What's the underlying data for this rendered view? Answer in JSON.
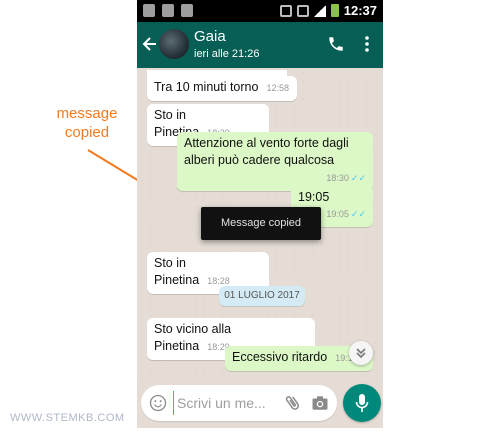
{
  "annotation": {
    "label": "message copied",
    "color": "#f47a20"
  },
  "watermark": {
    "text": "WWW.STEMKB.COM",
    "color": "#b0b8c8"
  },
  "status_bar": {
    "time": "12:37",
    "icons": [
      "facebook-icon",
      "image-icon",
      "recycle-icon",
      "vibrate-icon",
      "network-icon",
      "signal-icon",
      "battery-icon"
    ]
  },
  "header": {
    "contact_name": "Gaia",
    "last_seen": "ieri alle 21:26",
    "color": "#075e54",
    "icons": [
      "back-arrow-icon",
      "avatar",
      "phone-icon",
      "more-vert-icon"
    ]
  },
  "messages": [
    {
      "dir": "in",
      "text": "Tra 10 minuti torno",
      "time": "12:58"
    },
    {
      "dir": "in",
      "text": "Sto in Pinetina",
      "time": "18:29"
    },
    {
      "dir": "out",
      "text": "Attenzione al vento forte dagli alberi può cadere qualcosa",
      "time": "18:30"
    },
    {
      "dir": "out",
      "text": "19:05",
      "time": "19:05"
    },
    {
      "dir": "in",
      "text": "Sto in Pinetina",
      "time": "18:28"
    },
    {
      "dir": "in",
      "text": "Sto vicino alla Pinetina",
      "time": "18:29"
    },
    {
      "dir": "out",
      "text": "Eccessivo ritardo",
      "time": "19:1"
    }
  ],
  "date_chip": "01 LUGLIO 2017",
  "toast": "Message copied",
  "composer": {
    "placeholder": "Scrivi un me...",
    "value": ""
  },
  "colors": {
    "incoming": "#ffffff",
    "outgoing": "#dcf8c6",
    "chat_bg": "#e5ddd5",
    "read_ticks": "#4fc3f7",
    "mic_button": "#00897b"
  }
}
